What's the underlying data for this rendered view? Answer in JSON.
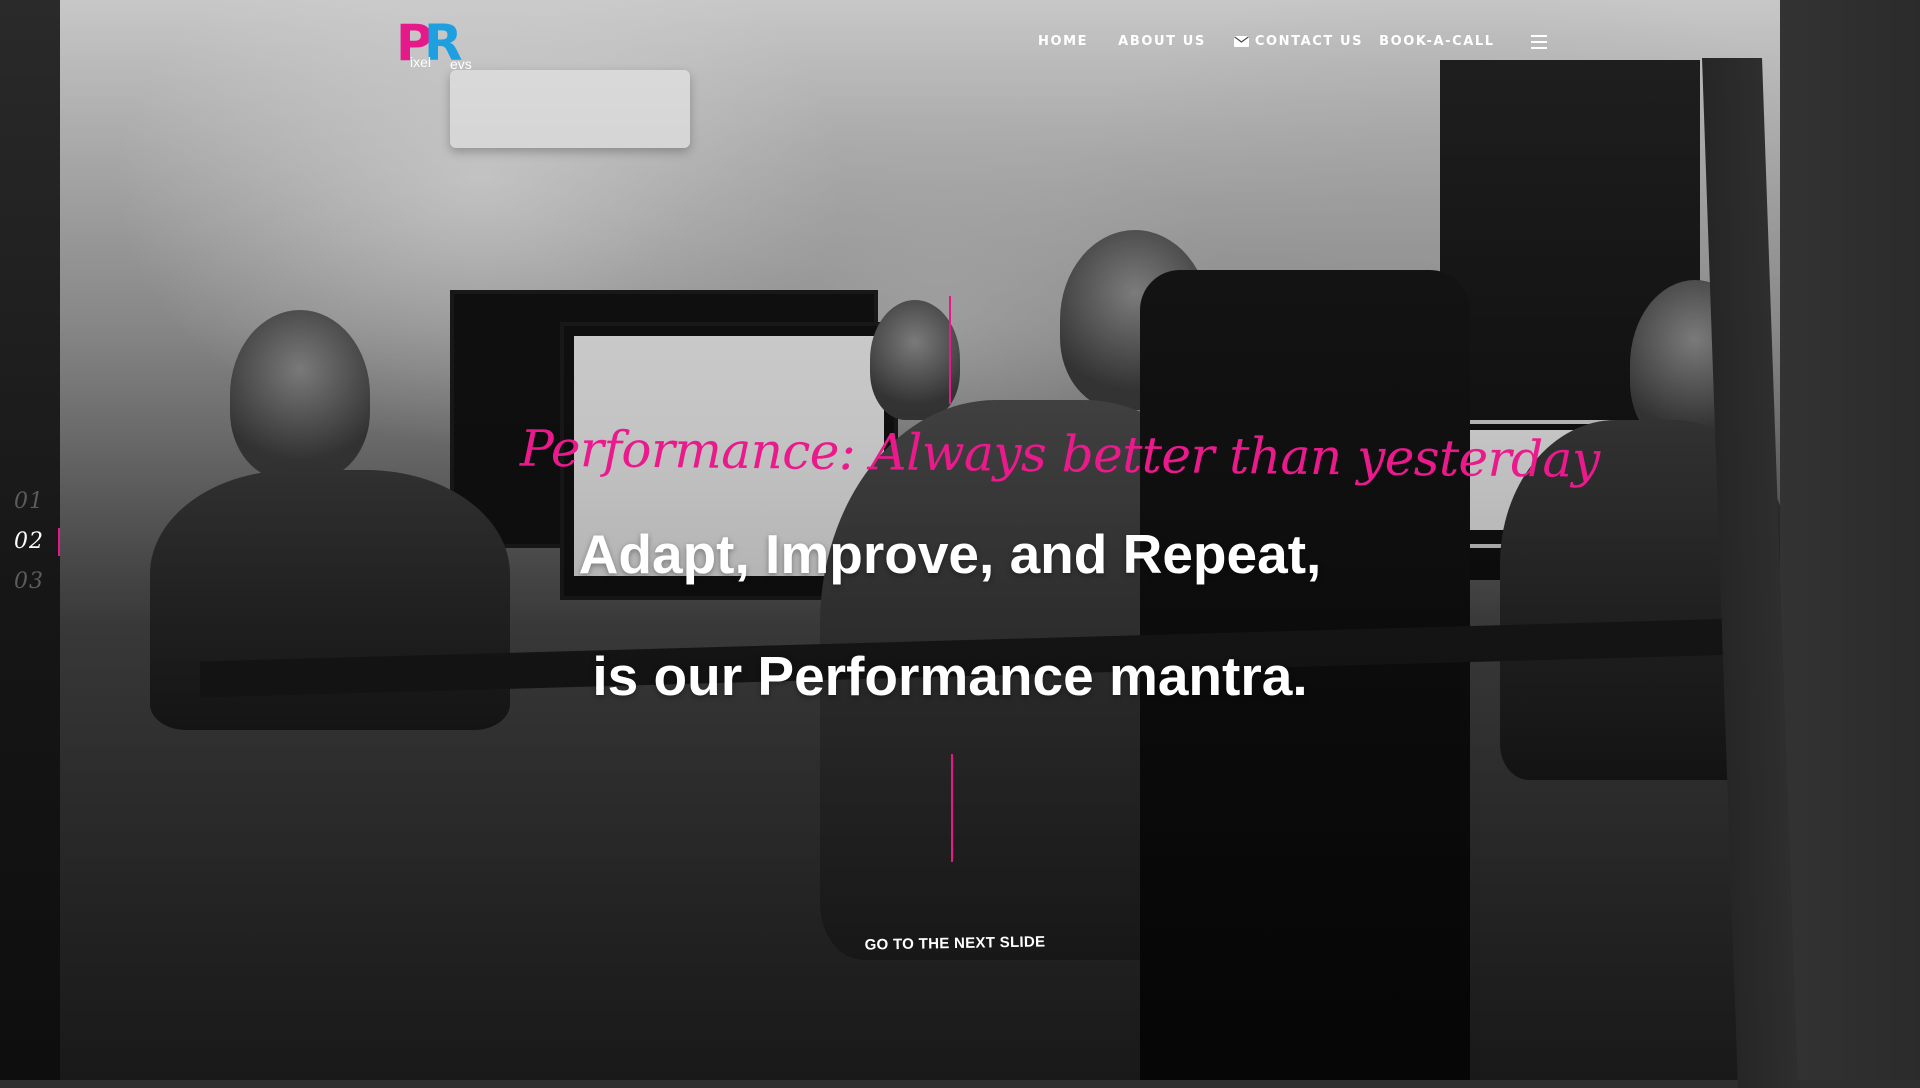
{
  "brand": {
    "logo_letter_1": "P",
    "logo_letter_2": "R",
    "logo_word_1": "ixel",
    "logo_word_2": "evs",
    "pink": "#e6198a",
    "blue": "#1ea0e0"
  },
  "nav": {
    "home": "HOME",
    "about": "ABOUT US",
    "contact": "CONTACT US",
    "book": "BOOK-A-CALL",
    "contact_icon": "envelope-icon",
    "menu_icon": "hamburger-menu-icon"
  },
  "slider": {
    "numbers": [
      "01",
      "02",
      "03"
    ],
    "active_index": 1
  },
  "hero": {
    "subtitle": "Performance: Always better than yesterday",
    "headline_line1": "Adapt, Improve, and Repeat,",
    "headline_line2": "is our Performance mantra.",
    "next_slide_label": "GO TO THE NEXT SLIDE"
  },
  "colors": {
    "accent": "#e6198a",
    "text": "#ffffff",
    "background": "#2e2e2e"
  }
}
